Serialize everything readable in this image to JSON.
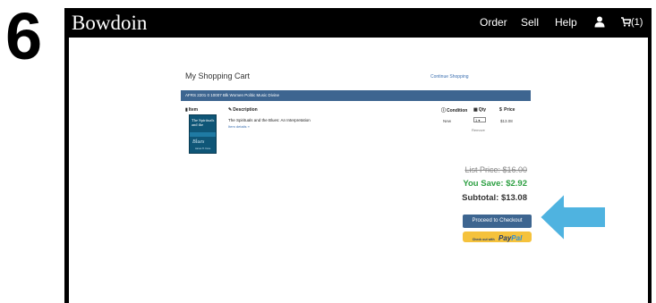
{
  "step_number": "6",
  "navbar": {
    "brand": "Bowdoin",
    "items": [
      "Order",
      "Sell",
      "Help"
    ],
    "cart_count": "(1)",
    "user_icon": "user-icon",
    "cart_icon": "cart-icon"
  },
  "cart": {
    "title": "My Shopping Cart",
    "continue_link": "Continue Shopping",
    "course_bar": "AFRS  2201  0  10007  Blk Women Politic Music Divine",
    "headers": {
      "item": "Item",
      "description": "Description",
      "condition": "Condition",
      "qty": "Qty",
      "price": "Price"
    },
    "line_item": {
      "cover_title": "The Spirituals and the",
      "cover_subtitle": "Blues",
      "cover_author": "James H. Cone",
      "description": "The Spirituals and the Blues: An Interpretation",
      "details_link": "Item details »",
      "condition": "New",
      "qty": "1",
      "remove": "Remove",
      "price": "$13.08"
    },
    "summary": {
      "list_price": "List Price: $16.00",
      "you_save": "You Save: $2.92",
      "subtotal": "Subtotal: $13.08"
    },
    "checkout_button": "Proceed to Checkout",
    "paypal": {
      "prefix": "Check out with",
      "brand_a": "Pay",
      "brand_b": "Pal"
    }
  },
  "colors": {
    "nav_bg": "#000000",
    "accent": "#3d6590",
    "save_green": "#2ea043",
    "paypal_yellow": "#f5c23c",
    "arrow_blue": "#4fb3e0"
  }
}
